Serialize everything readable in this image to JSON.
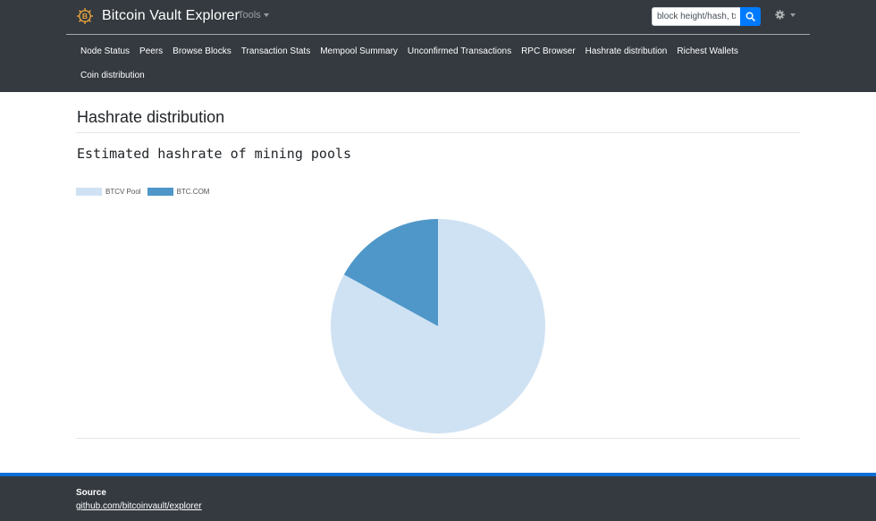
{
  "header": {
    "brand_name": "Bitcoin Vault Explorer",
    "tools_label": "Tools",
    "search_placeholder": "block height/hash, txid, or address"
  },
  "nav": {
    "row1": [
      "Node Status",
      "Peers",
      "Browse Blocks",
      "Transaction Stats",
      "Mempool Summary",
      "Unconfirmed Transactions",
      "RPC Browser",
      "Hashrate distribution",
      "Richest Wallets"
    ],
    "row2": [
      "Coin distribution"
    ]
  },
  "main": {
    "page_title": "Hashrate distribution",
    "chart_heading": "Estimated hashrate of mining pools"
  },
  "chart_data": {
    "type": "pie",
    "title": "",
    "categories": [
      "BTCV Pool",
      "BTC.COM"
    ],
    "values": [
      83,
      17
    ],
    "colors": [
      "#cfe2f3",
      "#4f97c9"
    ],
    "legend": "top-left"
  },
  "footer": {
    "source_label": "Source",
    "source_link": "github.com/bitcoinvault/explorer"
  },
  "colors": {
    "navbar": "#343a40",
    "accent": "#007bff",
    "footer_accent": "#0b6fd6"
  }
}
